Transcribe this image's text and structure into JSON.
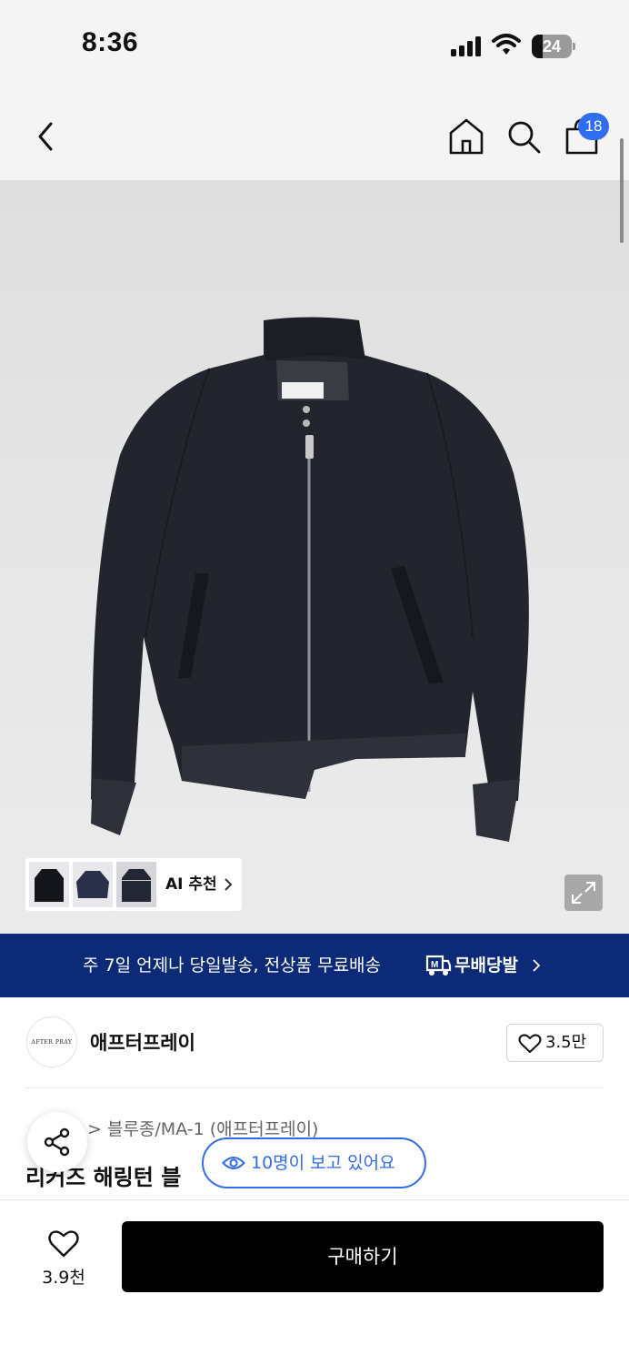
{
  "status_bar": {
    "time": "8:36",
    "battery": "24"
  },
  "header": {
    "cart_count": "18"
  },
  "gallery": {
    "ai_label": "AI 추천",
    "thumbnails": [
      "jacket-black",
      "bomber-navy",
      "jacket-navy-front"
    ],
    "main_image": "navy wool bomber jacket"
  },
  "shipping_banner": {
    "text": "주 7일 언제나 당일발송, 전상품 무료배송",
    "logo_label": "무배당발"
  },
  "brand": {
    "logo_text": "AFTER PRAY",
    "name": "애프터프레이",
    "likes": "3.5만"
  },
  "product": {
    "breadcrumb": "> 블루종/MA-1 (애프터프레이)",
    "title_visible": "리커즈 해링턴 블"
  },
  "viewers": {
    "text": "10명이 보고 있어요"
  },
  "bottom_bar": {
    "like_count": "3.9천",
    "buy_label": "구매하기"
  },
  "colors": {
    "accent_blue": "#2f6cf0",
    "banner_navy": "#0d2a78",
    "buy_button": "#000000"
  }
}
